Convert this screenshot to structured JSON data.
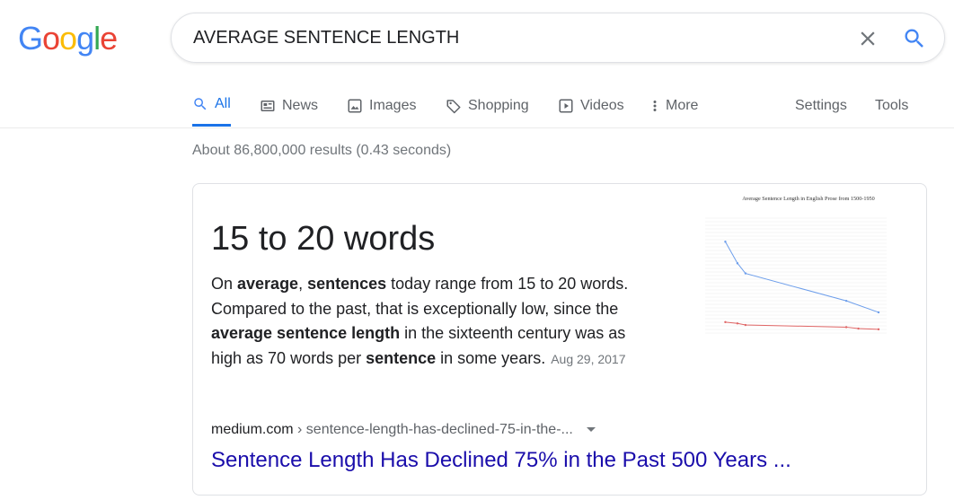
{
  "logo": {
    "letters": [
      "G",
      "o",
      "o",
      "g",
      "l",
      "e"
    ],
    "colors": [
      "#4285F4",
      "#EA4335",
      "#FBBC05",
      "#4285F4",
      "#34A853",
      "#EA4335"
    ]
  },
  "search": {
    "query": "AVERAGE SENTENCE LENGTH",
    "clear_icon": "close-icon",
    "search_icon": "search-icon"
  },
  "tabs": [
    {
      "label": "All",
      "icon": "search-icon",
      "active": true
    },
    {
      "label": "News",
      "icon": "news-icon"
    },
    {
      "label": "Images",
      "icon": "image-icon"
    },
    {
      "label": "Shopping",
      "icon": "tag-icon"
    },
    {
      "label": "Videos",
      "icon": "play-icon"
    },
    {
      "label": "More",
      "icon": "more-vert-icon"
    }
  ],
  "tools": {
    "settings": "Settings",
    "tools": "Tools"
  },
  "result_stats": "About 86,800,000 results (0.43 seconds)",
  "snippet": {
    "answer": "15 to 20 words",
    "text": [
      {
        "t": "On ",
        "b": false
      },
      {
        "t": "average",
        "b": true
      },
      {
        "t": ", ",
        "b": false
      },
      {
        "t": "sentences",
        "b": true
      },
      {
        "t": " today range from 15 to 20 words. Compared to the past, that is exceptionally low, since the ",
        "b": false
      },
      {
        "t": "average sentence length",
        "b": true
      },
      {
        "t": " in the sixteenth century was as high as 70 words per ",
        "b": false
      },
      {
        "t": "sentence",
        "b": true
      },
      {
        "t": " in some years.",
        "b": false
      }
    ],
    "date": "Aug 29, 2017",
    "cite_domain": "medium.com",
    "cite_path": " › sentence-length-has-declined-75-in-the-...",
    "link_title": "Sentence Length Has Declined 75% in the Past 500 Years ..."
  },
  "chart_data": {
    "type": "line",
    "title": "Average Sentence Length in English Prose from 1500-1950",
    "xlim": [
      1500,
      1950
    ],
    "ylim": [
      0,
      80
    ],
    "series": [
      {
        "x": [
          1550,
          1580,
          1600,
          1850,
          1930
        ],
        "values": [
          63.6,
          48.6,
          41.5,
          22.4,
          14.4
        ],
        "color": "#6d9eeb"
      },
      {
        "x": [
          1550,
          1580,
          1600,
          1850,
          1880,
          1930
        ],
        "values": [
          7.6,
          6.7,
          5.6,
          4.1,
          3.1,
          2.6
        ],
        "color": "#e06666"
      }
    ]
  }
}
